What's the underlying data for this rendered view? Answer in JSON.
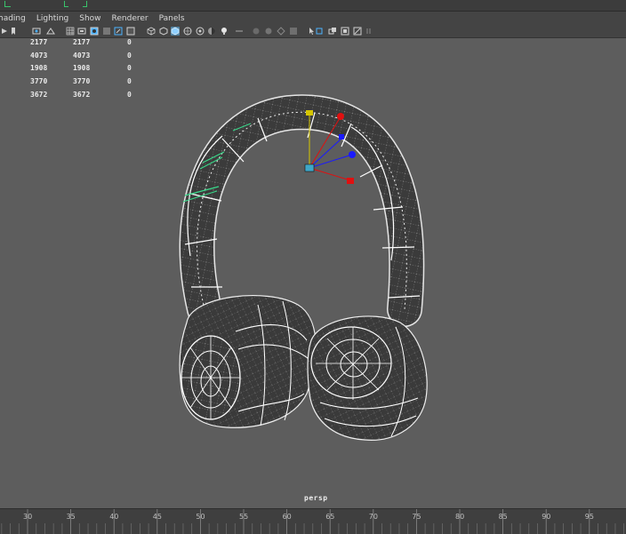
{
  "menu": {
    "items": [
      "hading",
      "Lighting",
      "Show",
      "Renderer",
      "Panels"
    ]
  },
  "toolbar": {
    "icons": [
      "camera-icon",
      "bookmark-icon",
      "image-plane-icon",
      "2d-pan-zoom-icon",
      "grid-icon",
      "film-gate-icon",
      "resolution-gate-icon",
      "gate-mask-icon",
      "field-chart-icon",
      "safe-action-icon",
      "wireframe-icon",
      "smooth-shade-icon",
      "default-material-icon",
      "textured-icon",
      "use-all-lights-icon",
      "shadows-icon",
      "screen-space-ao-icon",
      "motion-blur-icon",
      "anti-alias-icon",
      "depth-of-field-icon",
      "isolate-select-icon",
      "xray-icon",
      "xray-joints-icon",
      "backface-icon",
      "isolate-icon",
      "hud-icon"
    ]
  },
  "hud": {
    "rows": [
      [
        "2177",
        "2177",
        "0"
      ],
      [
        "4073",
        "4073",
        "0"
      ],
      [
        "1908",
        "1908",
        "0"
      ],
      [
        "3770",
        "3770",
        "0"
      ],
      [
        "3672",
        "3672",
        "0"
      ]
    ]
  },
  "viewport": {
    "camera_label": "persp",
    "object": "headphones-wireframe-mesh"
  },
  "timeline": {
    "ticks": [
      "30",
      "35",
      "40",
      "45",
      "50",
      "55",
      "60",
      "65",
      "70",
      "75",
      "80",
      "85",
      "90",
      "95"
    ]
  },
  "colors": {
    "background": "#5d5d5d",
    "mesh": "#3a3a3a",
    "wire": "#ffffff",
    "selected_wire": "#39d98a",
    "axis_x": "#e01010",
    "axis_y": "#d6c600",
    "axis_z": "#1a1aff"
  }
}
